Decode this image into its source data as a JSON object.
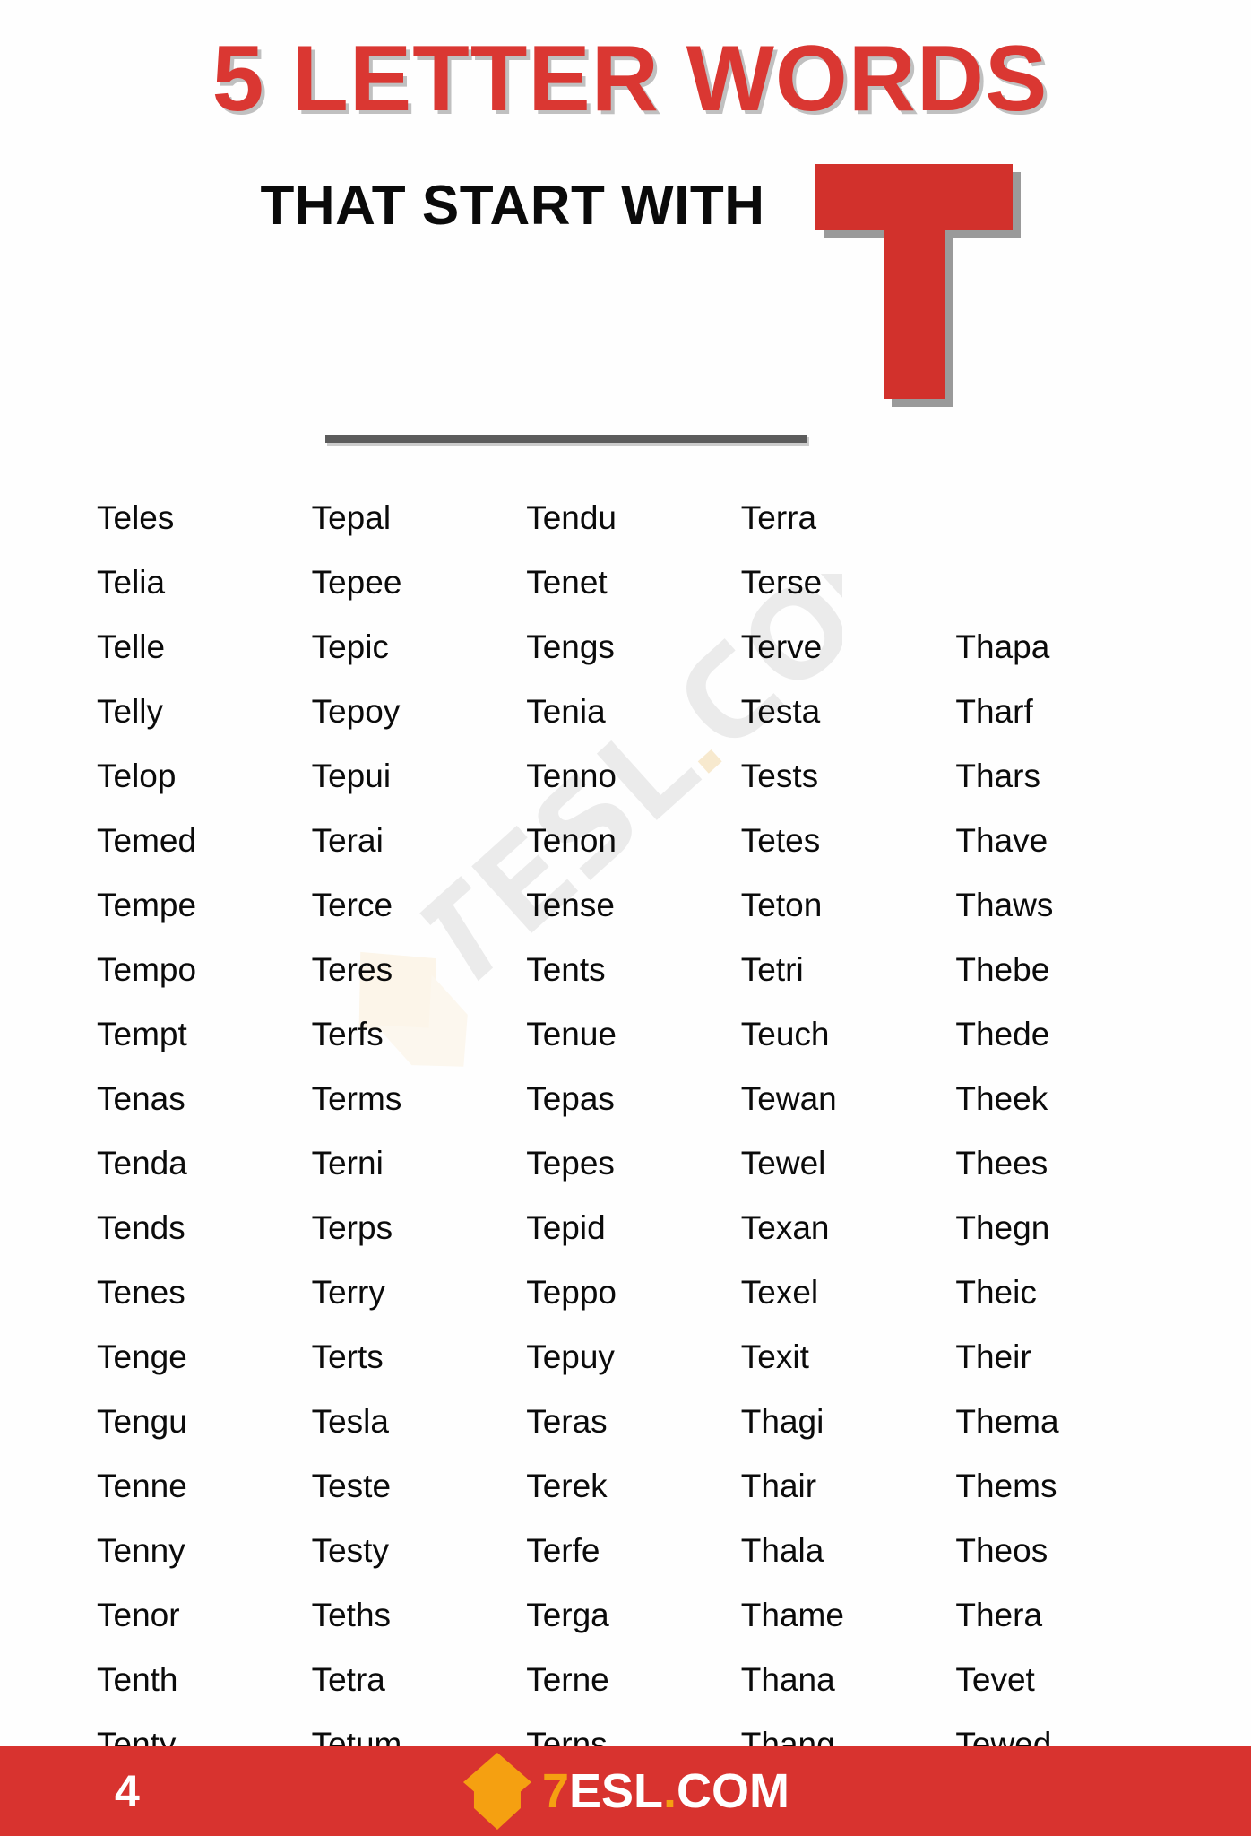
{
  "header": {
    "main_title": "5 LETTER WORDS",
    "subtitle": "THAT START WITH",
    "letter": "T",
    "title_color": "#DA3732",
    "letter_color": "#D2312C",
    "shadow_color": "#9A9A9A",
    "divider_color": "#5C5C5C"
  },
  "watermark": {
    "text": "7ESL.COM"
  },
  "columns": [
    {
      "id": "column-1",
      "words": [
        "Teles",
        "Telia",
        "Telle",
        "Telly",
        "Telop",
        "Temed",
        "Tempe",
        "Tempo",
        "Tempt",
        "Tenas",
        "Tenda",
        "Tends",
        "Tenes",
        "Tenge",
        "Tengu",
        "Tenne",
        "Tenny",
        "Tenor",
        "Tenth",
        "Tenty"
      ]
    },
    {
      "id": "column-2",
      "words": [
        "Tepal",
        "Tepee",
        "Tepic",
        "Tepoy",
        "Tepui",
        "Terai",
        "Terce",
        "Teres",
        "Terfs",
        "Terms",
        "Terni",
        "Terps",
        "Terry",
        "Terts",
        "Tesla",
        "Teste",
        "Testy",
        "Teths",
        "Tetra",
        "Tetum"
      ]
    },
    {
      "id": "column-3",
      "words": [
        "Tendu",
        "Tenet",
        "Tengs",
        "Tenia",
        "Tenno",
        "Tenon",
        "Tense",
        "Tents",
        "Tenue",
        "Tepas",
        "Tepes",
        "Tepid",
        "Teppo",
        "Tepuy",
        "Teras",
        "Terek",
        "Terfe",
        "Terga",
        "Terne",
        "Terns"
      ]
    },
    {
      "id": "column-4",
      "words": [
        "Terra",
        "Terse",
        "Terve",
        "Testa",
        "Tests",
        "Tetes",
        "Teton",
        "Tetri",
        "Teuch",
        "Tewan",
        "Tewel",
        "Texan",
        "Texel",
        "Texit",
        "Thagi",
        "Thair",
        "Thala",
        "Thame",
        "Thana",
        "Thang"
      ]
    },
    {
      "id": "column-5",
      "words": [
        "",
        "",
        "Thapa",
        "Tharf",
        "Thars",
        "Thave",
        "Thaws",
        "Thebe",
        "Thede",
        "Theek",
        "Thees",
        "Thegn",
        "Theic",
        "Their",
        "Thema",
        "Thems",
        "Theos",
        "Thera",
        "Tevet",
        "Tewed"
      ]
    }
  ],
  "footer": {
    "page_number": "4",
    "brand": {
      "seven": "7",
      "esl": "ESL",
      "dot": ".",
      "com": "COM"
    },
    "background_color": "#D8332F",
    "accent_color": "#F5A011"
  }
}
